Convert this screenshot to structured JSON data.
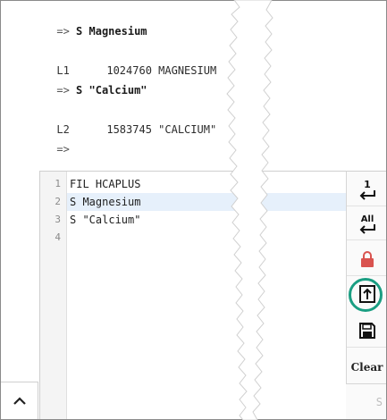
{
  "history": {
    "lines": [
      {
        "prompt": "=>",
        "command": "S Magnesium"
      },
      {
        "number": "L1",
        "result": "1024760 MAGNESIUM"
      },
      {
        "prompt": "=>",
        "command": "S \"Calcium\""
      },
      {
        "number": "L2",
        "result": "1583745 \"CALCIUM\""
      },
      {
        "prompt": "=>",
        "command": ""
      }
    ]
  },
  "editor": {
    "line_numbers": [
      "1",
      "2",
      "3",
      "4"
    ],
    "lines": [
      "FIL HCAPLUS",
      "S Magnesium",
      "S \"Calcium\"",
      ""
    ],
    "active_line": 2
  },
  "toolbar": {
    "buttons": [
      {
        "icon": "enter-line-icon",
        "glyph": "1"
      },
      {
        "icon": "enter-all-icon",
        "glyph": "All"
      },
      {
        "icon": "lock-icon"
      },
      {
        "icon": "upload-icon"
      },
      {
        "icon": "save-icon"
      },
      {
        "label": "Clear"
      }
    ],
    "highlight_color": "#1a9e82"
  },
  "footer": {
    "partial_text": "S"
  },
  "colors": {
    "active_line_bg": "#e6f0fb",
    "lock": "#d9534f",
    "accent": "#1a9e82"
  }
}
